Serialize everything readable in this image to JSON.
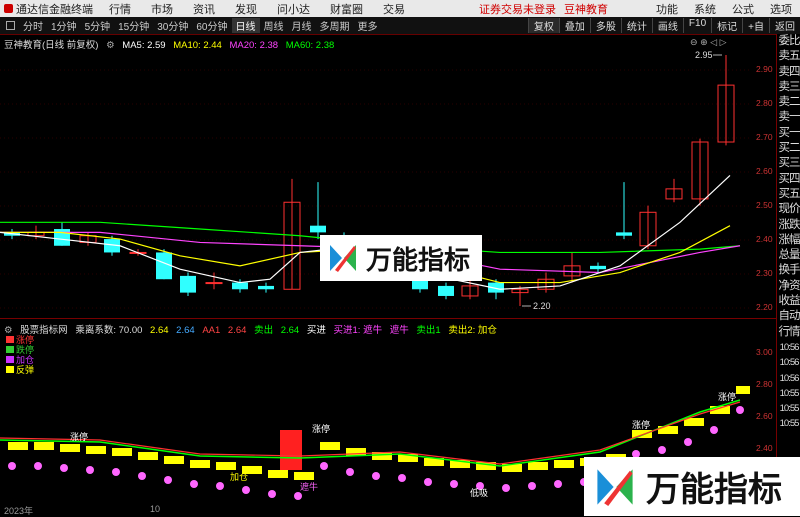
{
  "menubar": {
    "app_name": "通达信金融终端",
    "items": [
      "行情",
      "市场",
      "资讯",
      "发现",
      "问小达",
      "财富圈",
      "交易"
    ],
    "warning": "证券交易未登录",
    "user": "豆神教育",
    "right": [
      "功能",
      "系统",
      "公式",
      "选项"
    ]
  },
  "toolbar": {
    "timeframes": [
      "分时",
      "1分钟",
      "5分钟",
      "15分钟",
      "30分钟",
      "60分钟",
      "日线",
      "周线",
      "月线",
      "多周期",
      "更多"
    ],
    "active_timeframe": "日线",
    "tools": [
      "复权",
      "叠加",
      "多股",
      "统计",
      "画线",
      "F10",
      "标记",
      "+自",
      "返回"
    ]
  },
  "main_legend": {
    "label": "豆神教育(日线 前复权)",
    "ma5": "MA5: 2.59",
    "ma10": "MA10: 2.44",
    "ma20": "MA20: 2.38",
    "ma60": "MA60: 2.38",
    "colors": {
      "ma5": "#ffffff",
      "ma10": "#ffff00",
      "ma20": "#ff44ff",
      "ma60": "#00ff00"
    }
  },
  "main_chart": {
    "price_high_label": "2.95",
    "price_low_label": "2.20",
    "axis_ticks": [
      "2.90",
      "2.80",
      "2.70",
      "2.60",
      "2.50",
      "2.40",
      "2.30",
      "2.20"
    ]
  },
  "sub_legend": {
    "name": "股票指标网",
    "param": "乘离系数: 70.00",
    "v1": "2.64",
    "v2": "2.64",
    "v3_label": "AA1",
    "v3": "2.64",
    "sell_label": "卖出",
    "sell_val": "2.64",
    "buy_label": "买进",
    "buy1_label": "买进1: 遮牛",
    "hold": "遮牛",
    "sell1": "卖出1",
    "sell2": "卖出2: 加仓"
  },
  "sub_small_legend": [
    "涨停",
    "跌停",
    "加仓",
    "反弹"
  ],
  "sub_chart": {
    "axis_ticks": [
      "3.00",
      "2.80",
      "2.60",
      "2.40"
    ],
    "labels": {
      "zt": "涨停",
      "jc": "加仓",
      "zn": "遮牛",
      "dx": "低吸"
    }
  },
  "right_panel": [
    "委比",
    "卖五",
    "卖四",
    "卖三",
    "卖二",
    "卖一",
    "买一",
    "买二",
    "买三",
    "买四",
    "买五",
    "现价",
    "涨跌",
    "涨幅",
    "总量",
    "换手",
    "净资",
    "收益",
    "自动",
    "行情",
    "10:56",
    "10:56",
    "10:56",
    "10:55",
    "10:55",
    "10:55"
  ],
  "date_labels": [
    "2023年",
    "10"
  ],
  "watermark": {
    "text": "万能指标"
  }
}
